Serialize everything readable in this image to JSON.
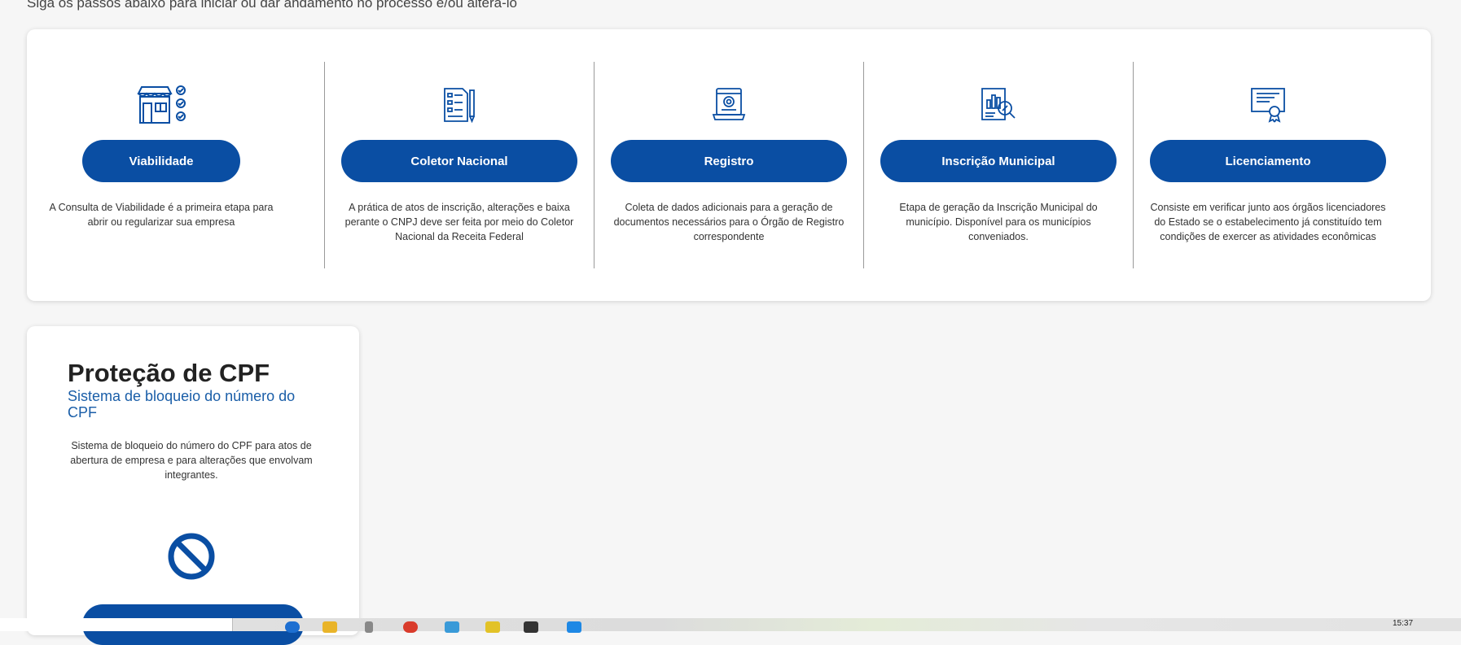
{
  "intro": "Siga os passos abaixo para iniciar ou dar andamento no processo e/ou alterá-lo",
  "steps": [
    {
      "label": "Viabilidade",
      "description": "A Consulta de Viabilidade é a primeira etapa para abrir ou regularizar sua empresa",
      "icon": "storefront-checklist-icon"
    },
    {
      "label": "Coletor Nacional",
      "description": "A prática de atos de inscrição, alterações e baixa perante o CNPJ deve ser feita por meio do Coletor Nacional da Receita Federal",
      "icon": "document-pen-icon"
    },
    {
      "label": "Registro",
      "description": "Coleta de dados adicionais para a geração de documentos necessários para o Órgão de Registro correspondente",
      "icon": "laptop-seal-icon"
    },
    {
      "label": "Inscrição Municipal",
      "description": "Etapa de geração da Inscrição Municipal do município. Disponível para os municípios conveniados.",
      "icon": "report-magnifier-icon"
    },
    {
      "label": "Licenciamento",
      "description": "Consiste em verificar junto aos órgãos licenciadores do Estado se o estabelecimento já constituído tem condições de exercer as atividades econômicas",
      "icon": "certificate-icon"
    }
  ],
  "cpf": {
    "title": "Proteção de CPF",
    "subtitle": "Sistema de bloqueio do número do CPF",
    "description": "Sistema de bloqueio do número do CPF para atos de abertura de empresa e para alterações que envolvam integrantes.",
    "icon": "block-icon"
  },
  "taskbar": {
    "time": "15:37"
  },
  "colors": {
    "primary": "#0a4ea3",
    "subtitle": "#1a5ea8",
    "background": "#f6f6f6"
  }
}
